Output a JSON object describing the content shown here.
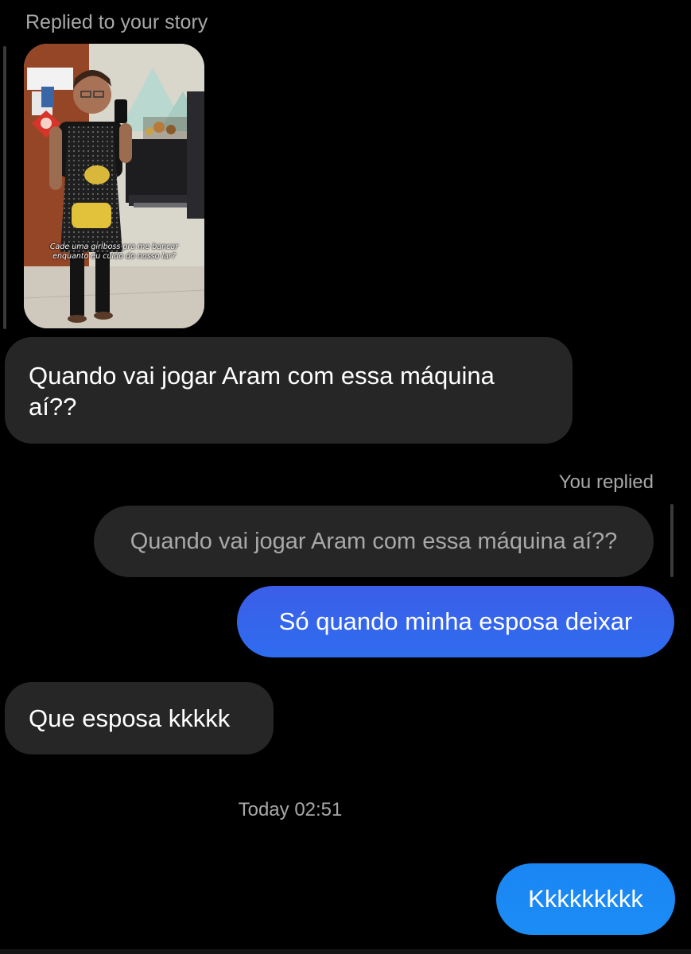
{
  "conversation": {
    "story_reply_caption": "Replied to your story",
    "story": {
      "overlay_text_line1": "Cade uma girlboss pra me bancar",
      "overlay_text_line2": "enquanto eu cuido do nosso lar?"
    },
    "messages": [
      {
        "direction": "incoming",
        "text": "Quando vai jogar Aram com essa máquina aí??"
      },
      {
        "direction": "outgoing",
        "reply_label": "You replied",
        "quoted_text": "Quando vai jogar Aram com essa máquina aí??",
        "text": "Só quando minha esposa deixar"
      },
      {
        "direction": "incoming",
        "text": "Que esposa kkkkk"
      },
      {
        "direction": "outgoing",
        "text": "Kkkkkkkkk"
      }
    ],
    "timestamp": "Today 02:51"
  },
  "colors": {
    "background": "#000000",
    "incoming_bubble": "#262626",
    "outgoing_bubble_gradient_top": "#3b5ee8",
    "outgoing_bubble_gradient_bottom": "#1c8cf5",
    "secondary_text": "#a8a8a8"
  }
}
